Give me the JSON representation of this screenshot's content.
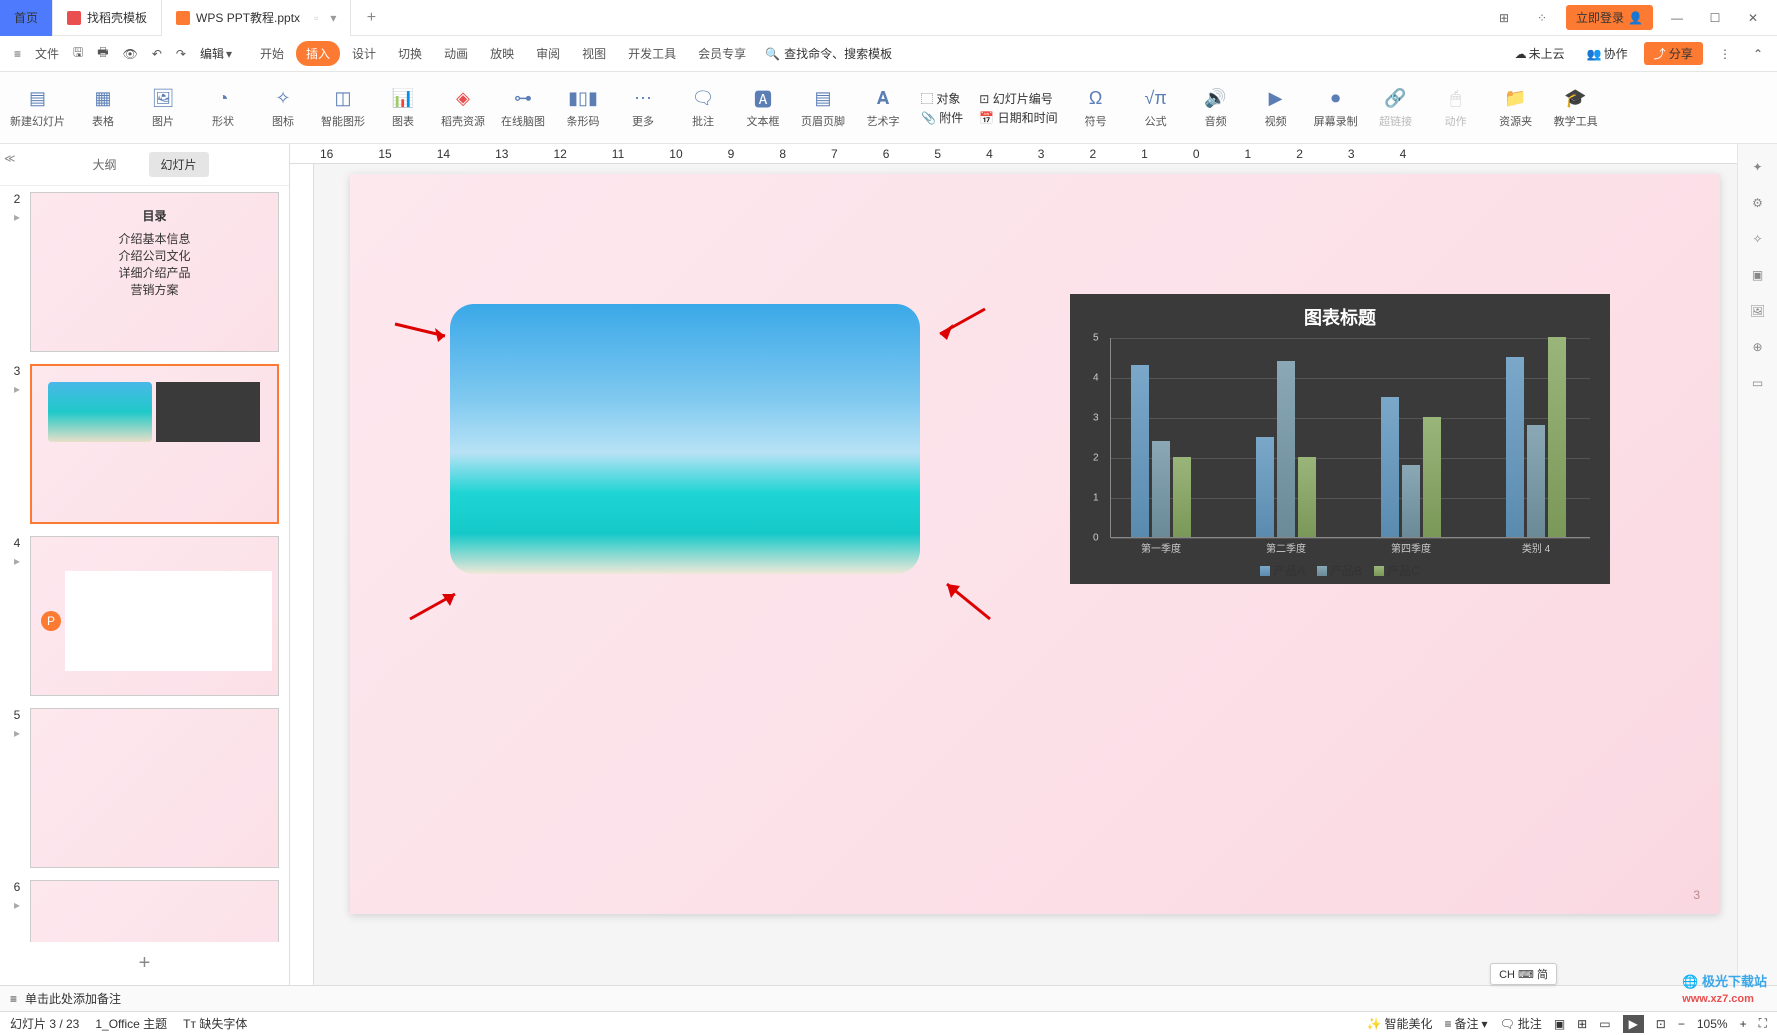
{
  "titlebar": {
    "home_tab": "首页",
    "tab1": "找稻壳模板",
    "tab2": "WPS PPT教程.pptx",
    "login": "立即登录"
  },
  "menubar": {
    "file": "文件",
    "edit": "编辑",
    "tabs": [
      "开始",
      "插入",
      "设计",
      "切换",
      "动画",
      "放映",
      "审阅",
      "视图",
      "开发工具",
      "会员专享"
    ],
    "active_tab": "插入",
    "search_placeholder": "查找命令、搜索模板",
    "not_cloud": "未上云",
    "collab": "协作",
    "share": "分享"
  },
  "ribbon": {
    "items": [
      "新建幻灯片",
      "表格",
      "图片",
      "形状",
      "图标",
      "智能图形",
      "图表",
      "稻壳资源",
      "在线脑图",
      "条形码",
      "更多",
      "批注",
      "文本框",
      "页眉页脚",
      "艺术字",
      "符号",
      "公式",
      "音频",
      "视频",
      "屏幕录制",
      "超链接",
      "动作",
      "资源夹",
      "教学工具"
    ],
    "obj": "对象",
    "slidenum": "幻灯片编号",
    "attach": "附件",
    "datetime": "日期和时间"
  },
  "leftpanel": {
    "tab_outline": "大纲",
    "tab_slides": "幻灯片",
    "slide2": {
      "title": "目录",
      "items": [
        "介绍基本信息",
        "介绍公司文化",
        "详细介绍产品",
        "营销方案"
      ]
    }
  },
  "chart_data": {
    "type": "bar",
    "title": "图表标题",
    "categories": [
      "第一季度",
      "第二季度",
      "第四季度",
      "类别 4"
    ],
    "series": [
      {
        "name": "产品A",
        "values": [
          4.3,
          2.5,
          3.5,
          4.5
        ]
      },
      {
        "name": "产品B",
        "values": [
          2.4,
          4.4,
          1.8,
          2.8
        ]
      },
      {
        "name": "产品C",
        "values": [
          2.0,
          2.0,
          3.0,
          5.0
        ]
      }
    ],
    "ylim": [
      0,
      5
    ],
    "yticks": [
      0,
      1,
      2,
      3,
      4,
      5
    ]
  },
  "slide": {
    "page_num": "3"
  },
  "notes": {
    "placeholder": "单击此处添加备注"
  },
  "ime": "CH ⌨ 简",
  "statusbar": {
    "slide_pos": "幻灯片 3 / 23",
    "theme": "1_Office 主题",
    "missing_font": "缺失字体",
    "beautify": "智能美化",
    "notes": "备注",
    "comments": "批注",
    "zoom": "105%"
  },
  "watermark": "极光下载站\nwww.xz7.com"
}
